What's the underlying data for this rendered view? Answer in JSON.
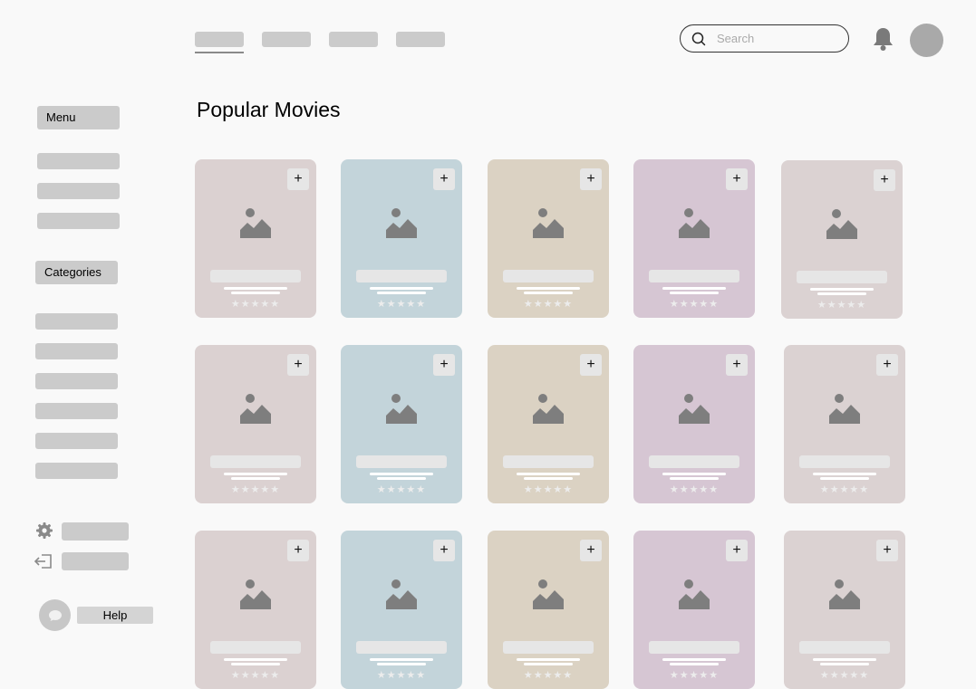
{
  "header": {
    "nav_items": [
      "",
      "",
      "",
      ""
    ],
    "search_placeholder": "Search"
  },
  "sidebar": {
    "menu_label": "Menu",
    "categories_label": "Categories",
    "help_label": "Help"
  },
  "main": {
    "title": "Popular Movies",
    "card_add_label": "+",
    "card_rating": "★★★★★",
    "card_colors": [
      "#dbd1d1",
      "#c3d4da",
      "#dbd2c3",
      "#d6c6d3",
      "#dbd2d2"
    ]
  }
}
